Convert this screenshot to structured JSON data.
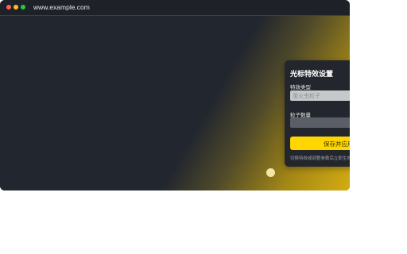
{
  "browser": {
    "url": "www.example.com"
  },
  "panel": {
    "title": "光标特效设置",
    "effect_type_label": "特效类型",
    "effect_type_value": "萤火虫粒子",
    "particle_count_label": "粒子数量",
    "particle_count_value": "",
    "save_label": "保存并应用",
    "hint": "切换特效或调整参数后立即生效"
  },
  "colors": {
    "accent": "#ffd600",
    "background": "#22262e",
    "panel": "#23262c"
  }
}
